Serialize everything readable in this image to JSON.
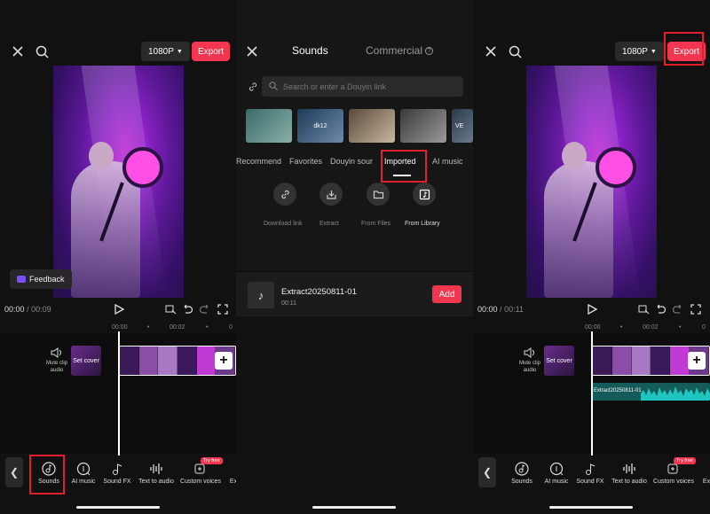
{
  "colors": {
    "accent": "#f2364f",
    "highlight_box": "#e0202f",
    "audio_track": "#145b5a"
  },
  "editor_left": {
    "resolution": "1080P",
    "export_label": "Export",
    "feedback_label": "Feedback",
    "time_current": "00:00",
    "time_sep": "/",
    "time_total": "00:09",
    "ruler": [
      "00:00",
      "•",
      "00:02",
      "•"
    ],
    "mute_label": "Mute clip audio",
    "cover_label": "Set cover",
    "tools": [
      "Sounds",
      "AI music",
      "Sound FX",
      "Text to audio",
      "Custom voices",
      "Ex"
    ],
    "try_free": "Try free"
  },
  "sounds": {
    "tab_sounds": "Sounds",
    "tab_commercial": "Commercial",
    "search_placeholder": "Search or enter a Douyin link",
    "thumbs": [
      "",
      "dk12",
      "",
      "",
      "VE"
    ],
    "categories": [
      "Recommend",
      "Favorites",
      "Douyin sour",
      "Imported",
      "AI music"
    ],
    "import_options": [
      "Download link",
      "Extract",
      "From Files",
      "From Library"
    ],
    "track_name": "Extract20250811-01",
    "track_duration": "00:11",
    "add_label": "Add"
  },
  "editor_right": {
    "resolution": "1080P",
    "export_label": "Export",
    "time_current": "00:00",
    "time_sep": "/",
    "time_total": "00:11",
    "ruler": [
      "00:00",
      "•",
      "00:02",
      "•"
    ],
    "mute_label": "Mute clip audio",
    "cover_label": "Set cover",
    "audio_clip_label": "Extract20250811-01",
    "tools": [
      "Sounds",
      "AI music",
      "Sound FX",
      "Text to audio",
      "Custom voices",
      "Ex"
    ],
    "try_free": "Try free"
  }
}
